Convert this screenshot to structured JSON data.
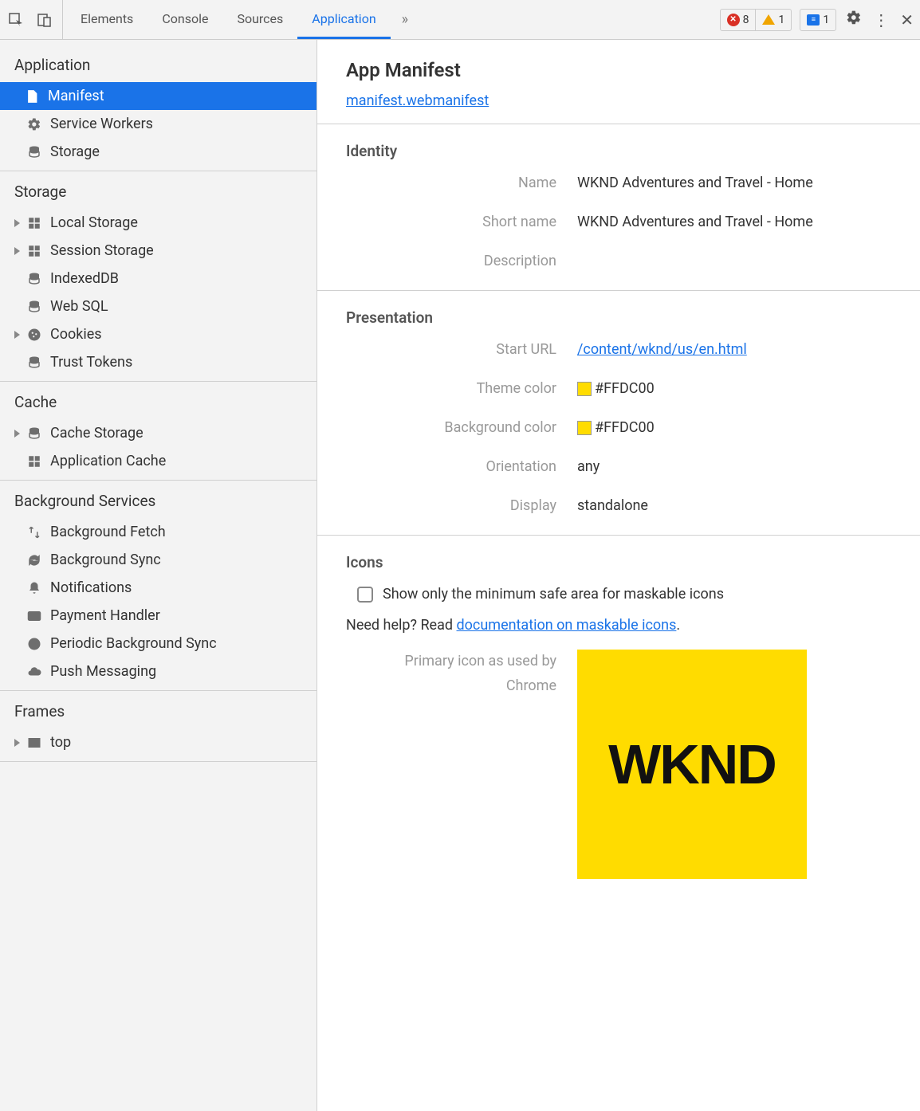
{
  "toolbar": {
    "tabs": [
      "Elements",
      "Console",
      "Sources",
      "Application"
    ],
    "active_tab": 3,
    "errors": "8",
    "warnings": "1",
    "messages": "1"
  },
  "sidebar": {
    "sections": [
      {
        "title": "Application",
        "items": [
          {
            "label": "Manifest",
            "icon": "file",
            "selected": true,
            "expandable": false
          },
          {
            "label": "Service Workers",
            "icon": "gear",
            "expandable": false
          },
          {
            "label": "Storage",
            "icon": "db",
            "expandable": false
          }
        ]
      },
      {
        "title": "Storage",
        "items": [
          {
            "label": "Local Storage",
            "icon": "grid",
            "expandable": true
          },
          {
            "label": "Session Storage",
            "icon": "grid",
            "expandable": true
          },
          {
            "label": "IndexedDB",
            "icon": "db",
            "expandable": false
          },
          {
            "label": "Web SQL",
            "icon": "db",
            "expandable": false
          },
          {
            "label": "Cookies",
            "icon": "cookie",
            "expandable": true
          },
          {
            "label": "Trust Tokens",
            "icon": "db",
            "expandable": false
          }
        ]
      },
      {
        "title": "Cache",
        "items": [
          {
            "label": "Cache Storage",
            "icon": "db",
            "expandable": true
          },
          {
            "label": "Application Cache",
            "icon": "grid",
            "expandable": false
          }
        ]
      },
      {
        "title": "Background Services",
        "items": [
          {
            "label": "Background Fetch",
            "icon": "fetch",
            "expandable": false
          },
          {
            "label": "Background Sync",
            "icon": "sync",
            "expandable": false
          },
          {
            "label": "Notifications",
            "icon": "bell",
            "expandable": false
          },
          {
            "label": "Payment Handler",
            "icon": "card",
            "expandable": false
          },
          {
            "label": "Periodic Background Sync",
            "icon": "clock",
            "expandable": false
          },
          {
            "label": "Push Messaging",
            "icon": "cloud",
            "expandable": false
          }
        ]
      },
      {
        "title": "Frames",
        "items": [
          {
            "label": "top",
            "icon": "frame",
            "expandable": true
          }
        ]
      }
    ]
  },
  "manifest": {
    "title": "App Manifest",
    "file_link": "manifest.webmanifest",
    "identity": {
      "section_title": "Identity",
      "name_label": "Name",
      "name_value": "WKND Adventures and Travel - Home",
      "shortname_label": "Short name",
      "shortname_value": "WKND Adventures and Travel - Home",
      "description_label": "Description",
      "description_value": ""
    },
    "presentation": {
      "section_title": "Presentation",
      "starturl_label": "Start URL",
      "starturl_value": "/content/wknd/us/en.html",
      "themecolor_label": "Theme color",
      "themecolor_value": "#FFDC00",
      "bgcolor_label": "Background color",
      "bgcolor_value": "#FFDC00",
      "orientation_label": "Orientation",
      "orientation_value": "any",
      "display_label": "Display",
      "display_value": "standalone"
    },
    "icons": {
      "section_title": "Icons",
      "checkbox_label": "Show only the minimum safe area for maskable icons",
      "help_prefix": "Need help? Read ",
      "help_link": "documentation on maskable icons",
      "help_suffix": ".",
      "primary_label_line1": "Primary icon as used by",
      "primary_label_line2": "Chrome",
      "icon_text": "WKND",
      "icon_bg": "#ffdc00"
    }
  }
}
